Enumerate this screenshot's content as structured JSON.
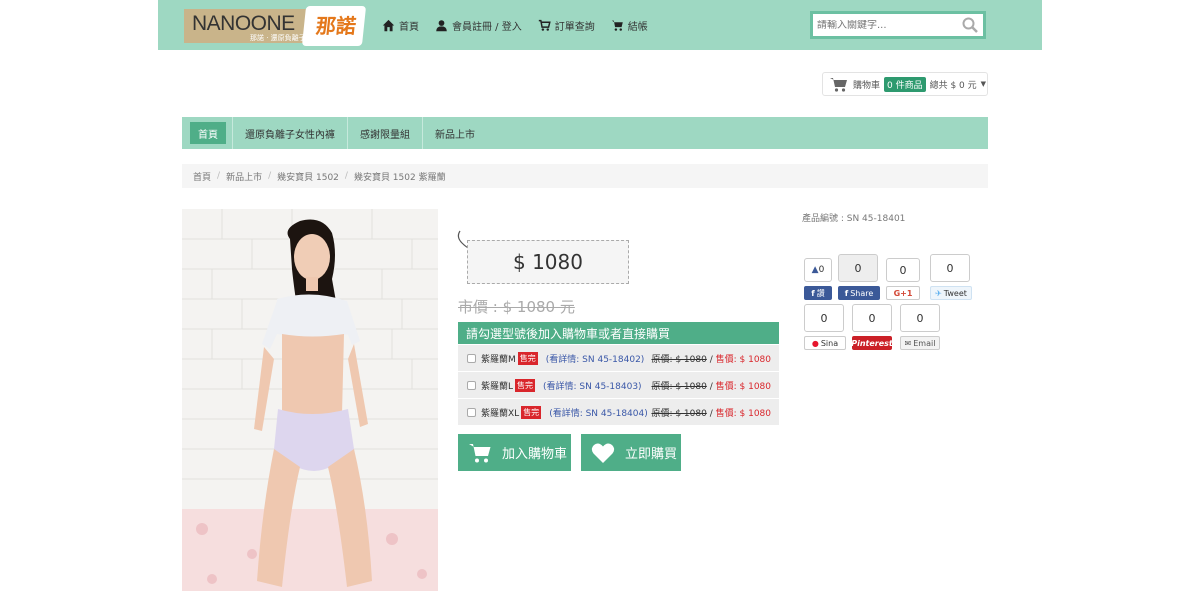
{
  "header": {
    "logo_text": "NANOONE",
    "logo_tagline": "那諾 · 還原負離子",
    "logo_badge": "那諾",
    "nav": [
      {
        "label": "首頁",
        "icon": "home-icon"
      },
      {
        "label": "會員註冊 / 登入",
        "icon": "user-icon"
      },
      {
        "label": "訂單查詢",
        "icon": "cart-icon"
      },
      {
        "label": "結帳",
        "icon": "checkout-cart-icon"
      }
    ],
    "search_placeholder": "請輸入關鍵字..."
  },
  "cart_summary": {
    "label": "購物車",
    "count": "0 件商品",
    "total": "總共 $ 0 元"
  },
  "categories": [
    "首頁",
    "還原負離子女性內褲",
    "感謝限量組",
    "新品上市"
  ],
  "breadcrumb": [
    "首頁",
    "新品上市",
    "幾安寶貝 1502",
    "幾安寶貝 1502 紫羅蘭"
  ],
  "product": {
    "price": "$ 1080",
    "market_price": "市價 : $ 1080 元",
    "options_title": "請勾選型號後加入購物車或者直接購買",
    "variants": [
      {
        "name": "紫羅蘭M",
        "status": "售完",
        "sn": "(看詳情: SN 45-18402)",
        "orig": "原價: $ 1080",
        "sale": "售價: $ 1080"
      },
      {
        "name": "紫羅蘭L",
        "status": "售完",
        "sn": "(看詳情: SN 45-18403)",
        "orig": "原價: $ 1080",
        "sale": "售價: $ 1080"
      },
      {
        "name": "紫羅蘭XL",
        "status": "售完",
        "sn": "(看詳情: SN 45-18404)",
        "orig": "原價: $ 1080",
        "sale": "售價: $ 1080"
      }
    ],
    "add_to_cart": "加入購物車",
    "buy_now": "立即購買",
    "code": "產品編號 : SN 45-18401"
  },
  "social": {
    "like_count": "0",
    "fb_share_count": "0",
    "gplus_count": "0",
    "tweet_count": "0",
    "sina_count": "0",
    "pinterest_count": "0",
    "email_count": "0",
    "like_label": "讚",
    "share_label": "Share",
    "gplus_label": "G+1",
    "tweet_label": "Tweet",
    "sina_label": "Sina",
    "pinterest_label": "Pinterest",
    "email_label": "Email"
  },
  "colors": {
    "mint": "#9ed8c2",
    "green": "#4fae88",
    "red": "#d9262c",
    "facebook": "#3b5998",
    "twitter": "#55acee",
    "pinterest": "#cb2027"
  }
}
